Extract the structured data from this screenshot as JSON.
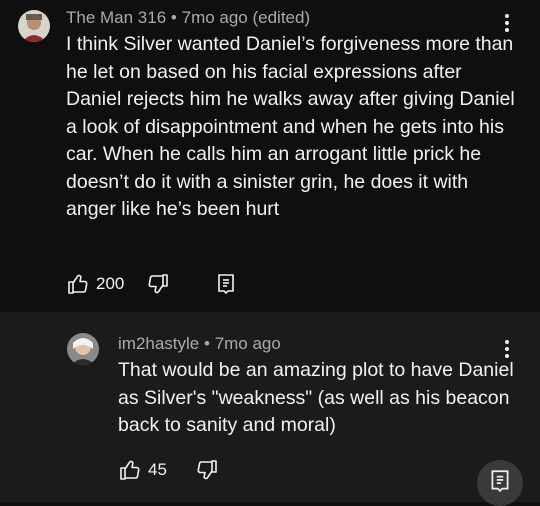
{
  "comment": {
    "author": "The Man 316",
    "separator": "•",
    "time": "7mo ago (edited)",
    "text": "I think Silver wanted Daniel’s forgiveness more than he let on based on his facial expressions after Daniel rejects him he walks away after giving Daniel a look of disappointment and when he gets into his car. When he calls him an arrogant little prick he doesn’t do it with a sinister grin, he does it with anger like he’s been hurt",
    "likes": "200",
    "icons": [
      "thumbs-up-icon",
      "thumbs-down-icon",
      "reply-icon",
      "more-vert-icon"
    ]
  },
  "reply": {
    "author": "im2hastyle",
    "separator": "•",
    "time": "7mo ago",
    "text": "That would be an amazing plot to have Daniel as Silver's \"weakness\" (as well as his beacon back to sanity and moral)",
    "likes": "45",
    "icons": [
      "thumbs-up-icon",
      "thumbs-down-icon",
      "more-vert-icon"
    ]
  },
  "fab": {
    "icon": "reply-icon"
  },
  "colors": {
    "background": "#0f0f0f",
    "reply_background": "#1b1b1b",
    "text": "#f1f1f1",
    "meta": "#aaaaaa"
  }
}
